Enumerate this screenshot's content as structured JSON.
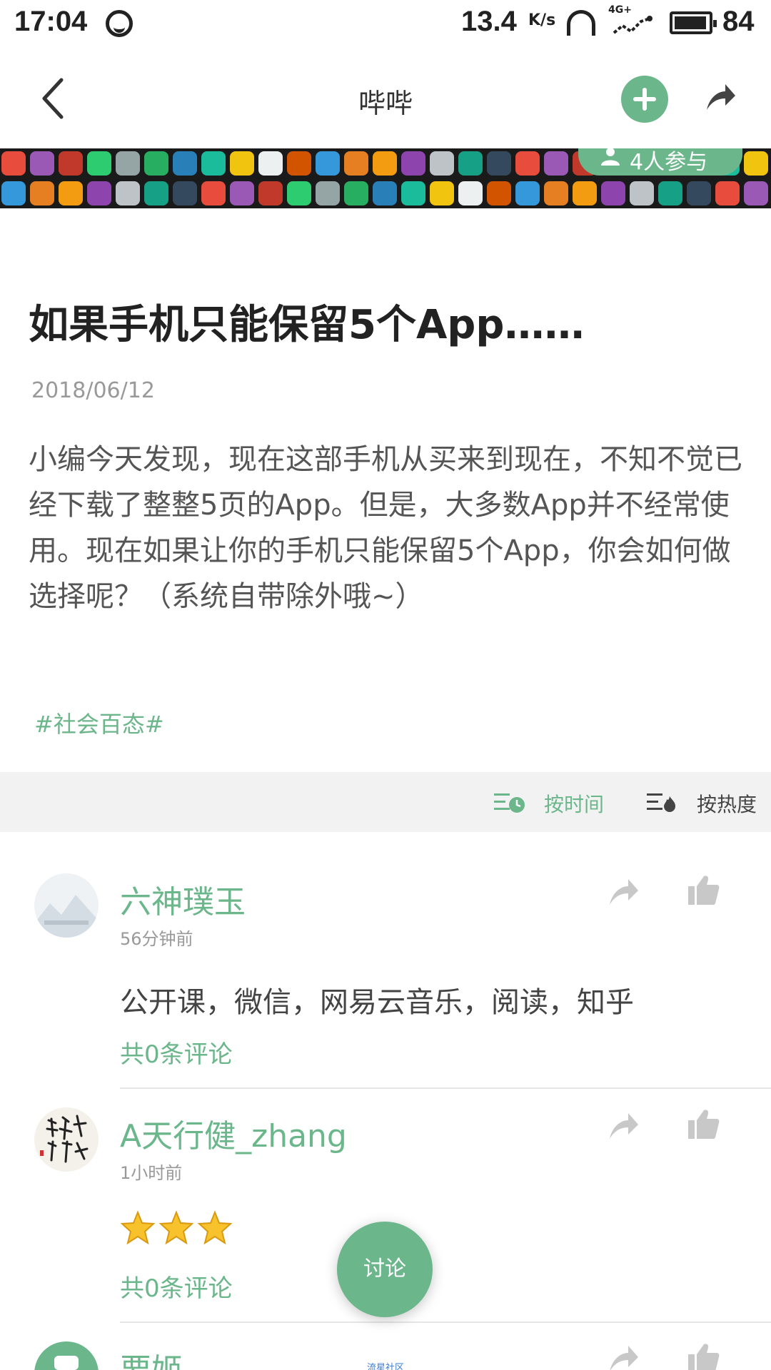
{
  "status_bar": {
    "time": "17:04",
    "speed": "13.4",
    "speed_unit": "K/s",
    "network": "4G+",
    "battery": "84"
  },
  "header": {
    "title": "哔哔"
  },
  "banner": {
    "participants": "4人参与"
  },
  "article": {
    "title": "如果手机只能保留5个App……",
    "date": "2018/06/12",
    "body": "小编今天发现，现在这部手机从买来到现在，不知不觉已经下载了整整5页的App。但是，大多数App并不经常使用。现在如果让你的手机只能保留5个App，你会如何做选择呢？（系统自带除外哦~）",
    "tag": "#社会百态#"
  },
  "sort": {
    "by_time": "按时间",
    "by_hot": "按热度",
    "active": "by_time"
  },
  "comments": [
    {
      "name": "六神璞玉",
      "time": "56分钟前",
      "text": "公开课，微信，网易云音乐，阅读，知乎",
      "count": "共0条评论"
    },
    {
      "name": "A天行健_zhang",
      "time": "1小时前",
      "stars": 3,
      "count": "共0条评论"
    },
    {
      "name": "要姬"
    }
  ],
  "fab": {
    "label": "讨论"
  },
  "watermark": "流星社区",
  "colors": {
    "accent": "#6bb68b",
    "text_primary": "#222222",
    "text_secondary": "#999999",
    "sort_bar_bg": "#f2f2f2"
  }
}
